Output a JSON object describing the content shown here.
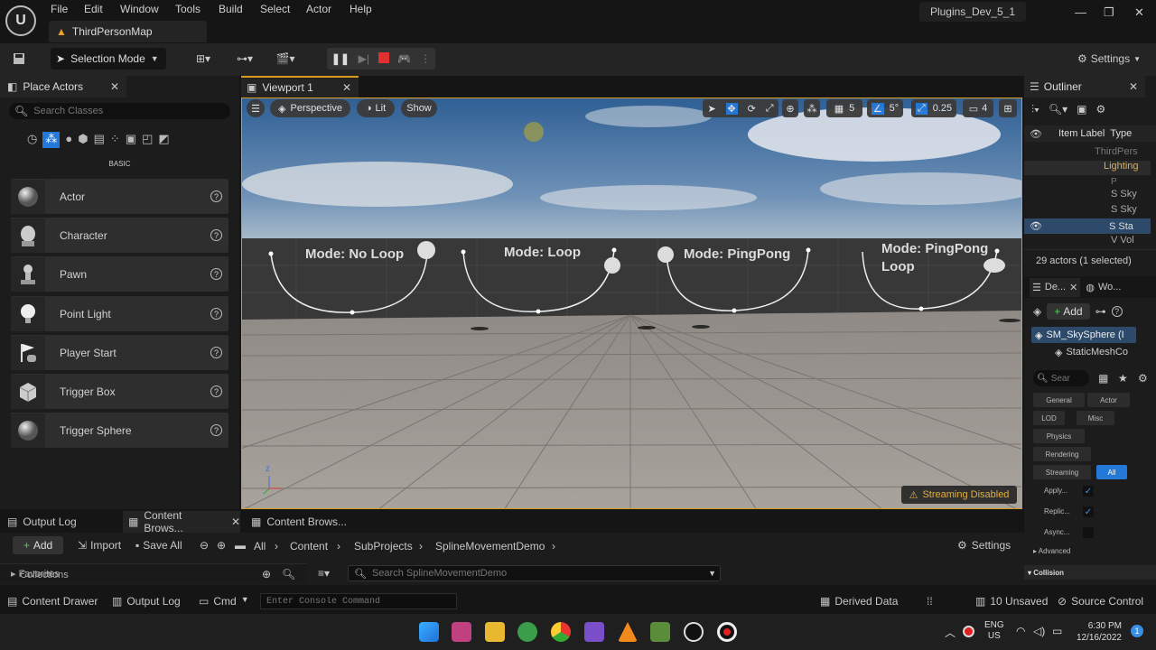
{
  "menu": {
    "items": [
      "File",
      "Edit",
      "Window",
      "Tools",
      "Build",
      "Select",
      "Actor",
      "Help"
    ]
  },
  "map_tab": "ThirdPersonMap",
  "project_name": "Plugins_Dev_5_1",
  "toolbar": {
    "selection_mode": "Selection Mode",
    "settings": "Settings"
  },
  "place_actors": {
    "title": "Place Actors",
    "search_placeholder": "Search Classes",
    "category": "BASIC",
    "items": [
      {
        "label": "Actor"
      },
      {
        "label": "Character"
      },
      {
        "label": "Pawn"
      },
      {
        "label": "Point Light"
      },
      {
        "label": "Player Start"
      },
      {
        "label": "Trigger Box"
      },
      {
        "label": "Trigger Sphere"
      }
    ]
  },
  "viewport": {
    "tab": "Viewport 1",
    "perspective": "Perspective",
    "lit": "Lit",
    "show": "Show",
    "grid_snap": "5",
    "rotation_snap": "5°",
    "scale_snap": "0.25",
    "camera_speed": "4",
    "modes": [
      "Mode: No Loop",
      "Mode: Loop",
      "Mode: PingPong",
      "Mode: PingPong Loop"
    ],
    "streaming_warning": "Streaming Disabled"
  },
  "outliner": {
    "title": "Outliner",
    "col_label": "Item Label",
    "col_type": "Type",
    "rows": [
      "ThirdPers",
      "Lighting",
      "P",
      "S Sky",
      "S Sky",
      "S Sta",
      "V Vol"
    ],
    "actor_count": "29 actors (1 selected)"
  },
  "details": {
    "tab1": "De...",
    "tab2": "Wo...",
    "add": "Add",
    "component_root": "SM_SkySphere (I",
    "component_child": "StaticMeshCo",
    "search_placeholder": "Sear",
    "categories": [
      "General",
      "Actor",
      "LOD",
      "Misc",
      "Physics",
      "Rendering",
      "Streaming",
      "All"
    ],
    "props": [
      "Apply...",
      "Replic...",
      "Async..."
    ],
    "advanced": "Advanced",
    "collision": "Collision"
  },
  "bottom_tabs": [
    "Output Log",
    "Content Brows...",
    "Content Brows..."
  ],
  "content_browser": {
    "add": "Add",
    "import": "Import",
    "save_all": "Save All",
    "breadcrumb": [
      "All",
      "Content",
      "SubProjects",
      "SplineMovementDemo"
    ],
    "settings": "Settings",
    "favorites": "Favorites",
    "collections": "Collections",
    "search_placeholder": "Search SplineMovementDemo"
  },
  "status_bar": {
    "content_drawer": "Content Drawer",
    "output_log": "Output Log",
    "cmd": "Cmd",
    "console_placeholder": "Enter Console Command",
    "derived_data": "Derived Data",
    "unsaved": "10 Unsaved",
    "source_control": "Source Control"
  },
  "taskbar": {
    "lang1": "ENG",
    "lang2": "US",
    "time": "6:30 PM",
    "date": "12/16/2022",
    "badge": "1"
  },
  "colors": {
    "accent": "#2478d8",
    "selection": "#2e4a6b",
    "viewport_border": "#d99a1e"
  }
}
